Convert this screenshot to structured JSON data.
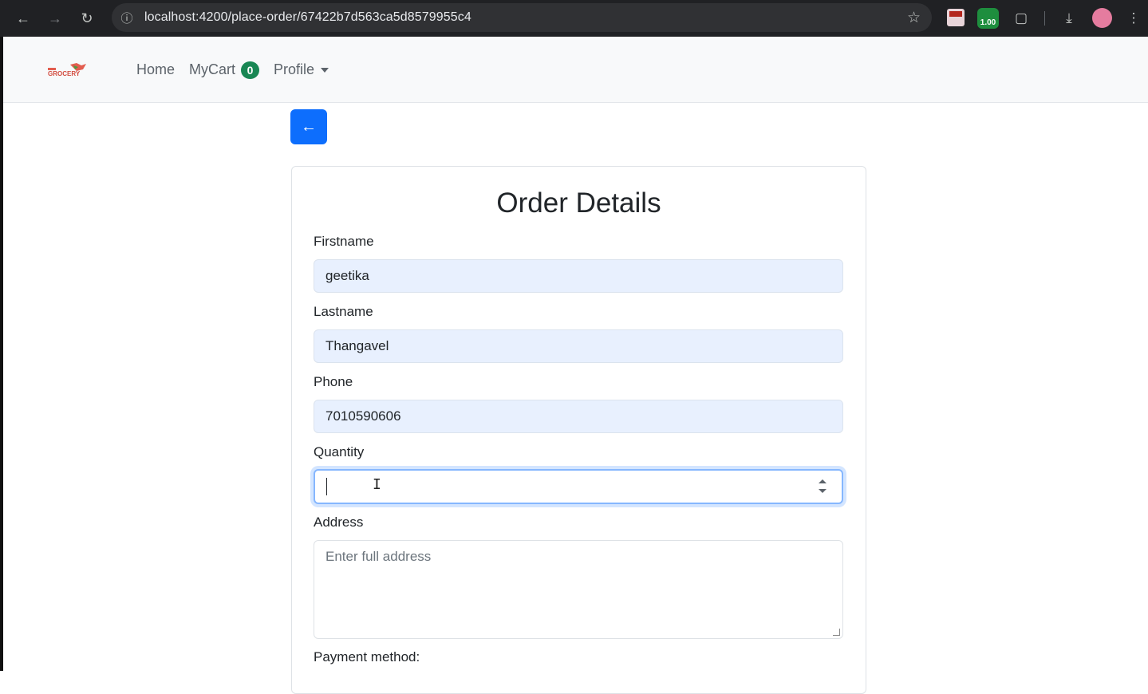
{
  "browser": {
    "url": "localhost:4200/place-order/67422b7d563ca5d8579955c4",
    "extension_badge": "1.00",
    "icons": [
      "back-icon",
      "forward-icon",
      "reload-icon",
      "info-icon",
      "star-icon",
      "extension-icon",
      "puzzle-icon",
      "download-icon",
      "profile-avatar",
      "more-menu-icon"
    ]
  },
  "navbar": {
    "logo_text": "GROCERY",
    "links": {
      "home": "Home",
      "cart": "MyCart",
      "profile": "Profile"
    },
    "cart_count": "0"
  },
  "back_button": {
    "icon": "arrow-left-icon",
    "glyph": "←"
  },
  "form": {
    "title": "Order Details",
    "firstname": {
      "label": "Firstname",
      "value": "geetika"
    },
    "lastname": {
      "label": "Lastname",
      "value": "Thangavel"
    },
    "phone": {
      "label": "Phone",
      "value": "7010590606"
    },
    "quantity": {
      "label": "Quantity",
      "value": ""
    },
    "address": {
      "label": "Address",
      "placeholder": "Enter full address"
    },
    "payment": {
      "label": "Payment method:"
    }
  },
  "colors": {
    "primary": "#0d6efd",
    "success": "#198754",
    "autofill": "#e8f0fe",
    "focus": "#86b7fe"
  }
}
